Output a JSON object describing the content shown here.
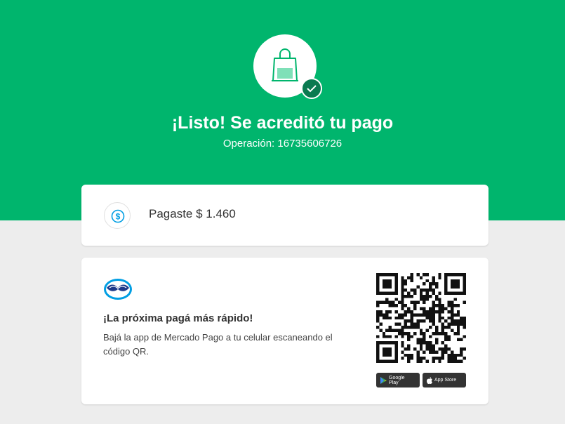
{
  "hero": {
    "title": "¡Listo! Se acreditó tu pago",
    "operation": "Operación: 16735606726"
  },
  "payment": {
    "text": "Pagaste $ 1.460",
    "icon": "dollar-coin-icon"
  },
  "app_promo": {
    "title": "¡La próxima pagá más rápido!",
    "description": "Bajá la app de Mercado Pago a tu celular escaneando el código QR.",
    "google_play_label": "Google Play",
    "app_store_label": "App Store"
  },
  "colors": {
    "brand_green": "#00b56d",
    "badge_green": "#0a7a50",
    "mp_blue": "#009ee3"
  }
}
